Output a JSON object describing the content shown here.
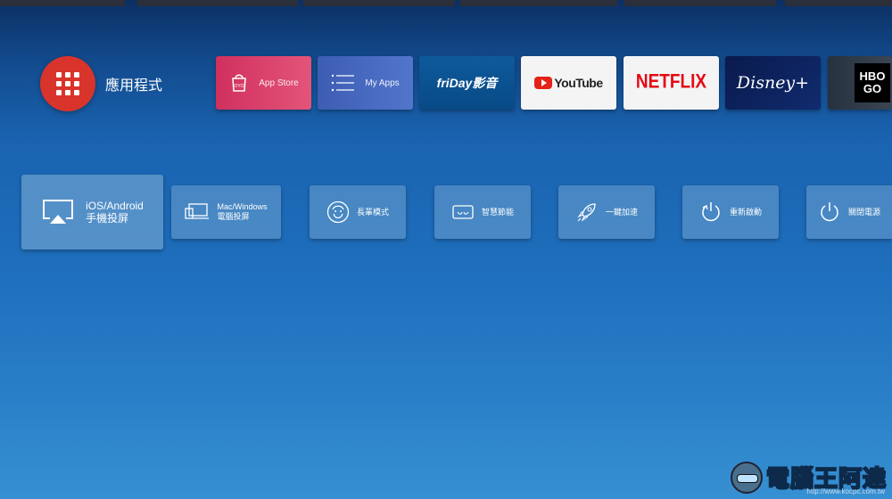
{
  "apps_row": {
    "launcher_label": "應用程式",
    "tiles": {
      "app_store": "App Store",
      "app_store_logo": "OYO",
      "my_apps": "My Apps",
      "friday": "friDay影音",
      "youtube": "YouTube",
      "netflix": "NETFLIX",
      "disney": "Disney+",
      "hbo_line1": "HBO",
      "hbo_line2": "GO"
    }
  },
  "function_row": {
    "mobile_cast_line1": "iOS/Android",
    "mobile_cast_line2": "手機投屏",
    "pc_cast_line1": "Mac/Windows",
    "pc_cast_line2": "電腦投屏",
    "elderly_mode": "長輩模式",
    "smart_energy": "智慧節能",
    "one_key_boost": "一鍵加速",
    "restart": "重新啟動",
    "power_off": "關閉電源"
  },
  "watermark": {
    "text": "電腦王阿達",
    "url": "http://www.kocpc.com.tw"
  },
  "colors": {
    "launcher_red": "#d9342b",
    "netflix_red": "#e50914",
    "youtube_red": "#e62117"
  },
  "icons": [
    "apps-grid-icon",
    "shopping-bag-icon",
    "list-icon",
    "airplay-icon",
    "laptop-cast-icon",
    "elder-face-icon",
    "energy-eye-icon",
    "rocket-icon",
    "restart-icon",
    "power-icon"
  ]
}
